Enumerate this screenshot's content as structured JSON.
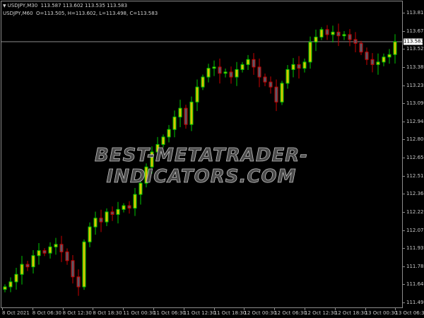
{
  "legend": {
    "line1": "USDJPY,M30  113.587 113.602 113.535 113.583",
    "line2": "USDJPY,M60  O=113.505, H=113.602, L=113.498, C=113.583"
  },
  "watermark": "BEST-METATRADER-INDICATORS.COM",
  "current_price": "113.583",
  "colors": {
    "bull_border": "#00c800",
    "bull_body": "#d8c400",
    "bear_border": "#c80000",
    "bear_body": "#5a5a66",
    "grid": "#8c8c8c",
    "price_line": "#8c8c8c"
  },
  "chart_data": {
    "type": "candlestick",
    "symbol": "USDJPY",
    "timeframe": "M30",
    "ylim": [
      111.495,
      113.815
    ],
    "y_ticks": [
      "113.815",
      "113.670",
      "113.525",
      "113.380",
      "113.235",
      "113.090",
      "112.945",
      "112.800",
      "112.655",
      "112.510",
      "112.365",
      "112.220",
      "112.075",
      "111.930",
      "111.785",
      "111.640",
      "111.495"
    ],
    "x_ticks": [
      "8 Oct 2021",
      "8 Oct 06:30",
      "8 Oct 12:30",
      "8 Oct 18:30",
      "11 Oct 00:30",
      "11 Oct 06:30",
      "11 Oct 12:30",
      "11 Oct 18:30",
      "12 Oct 00:30",
      "12 Oct 06:30",
      "12 Oct 12:30",
      "12 Oct 18:30",
      "13 Oct 00:30",
      "13 Oct 06:30"
    ],
    "open_first": 111.6,
    "closes": [
      111.62,
      111.66,
      111.72,
      111.8,
      111.78,
      111.87,
      111.91,
      111.89,
      111.94,
      111.96,
      111.9,
      111.83,
      111.7,
      111.62,
      111.98,
      112.1,
      112.17,
      112.14,
      112.22,
      112.2,
      112.24,
      112.27,
      112.25,
      112.36,
      112.45,
      112.58,
      112.7,
      112.76,
      112.82,
      112.88,
      112.98,
      113.05,
      112.92,
      113.1,
      113.22,
      113.3,
      113.37,
      113.38,
      113.33,
      113.34,
      113.3,
      113.36,
      113.4,
      113.44,
      113.38,
      113.3,
      113.26,
      113.22,
      113.1,
      113.25,
      113.36,
      113.4,
      113.37,
      113.42,
      113.58,
      113.62,
      113.68,
      113.64,
      113.66,
      113.63,
      113.64,
      113.6,
      113.57,
      113.5,
      113.44,
      113.4,
      113.42,
      113.46,
      113.48,
      113.583
    ]
  }
}
